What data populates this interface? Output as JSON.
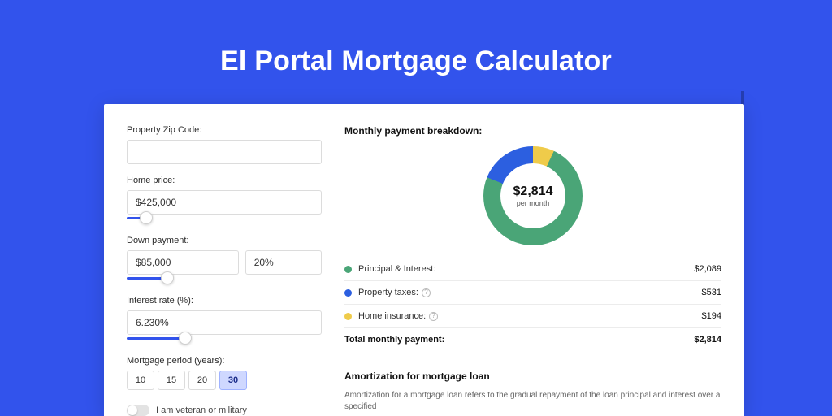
{
  "hero": {
    "title": "El Portal Mortgage Calculator"
  },
  "form": {
    "zip": {
      "label": "Property Zip Code:",
      "value": ""
    },
    "home_price": {
      "label": "Home price:",
      "value": "$425,000",
      "slider_pct": 10
    },
    "down_payment": {
      "label": "Down payment:",
      "amount": "$85,000",
      "percent": "20%",
      "slider_pct": 20
    },
    "interest_rate": {
      "label": "Interest rate (%):",
      "value": "6.230%",
      "slider_pct": 30
    },
    "period": {
      "label": "Mortgage period (years):",
      "options": [
        "10",
        "15",
        "20",
        "30"
      ],
      "active": "30"
    },
    "veteran": {
      "label": "I am veteran or military",
      "on": false
    }
  },
  "breakdown": {
    "title": "Monthly payment breakdown:",
    "center_amount": "$2,814",
    "center_sub": "per month",
    "items": [
      {
        "name": "Principal & Interest:",
        "value": "$2,089",
        "color": "#4aa577",
        "info": false
      },
      {
        "name": "Property taxes:",
        "value": "$531",
        "color": "#2c5fe0",
        "info": true
      },
      {
        "name": "Home insurance:",
        "value": "$194",
        "color": "#efcb4a",
        "info": true
      }
    ],
    "total_label": "Total monthly payment:",
    "total_value": "$2,814"
  },
  "amort": {
    "title": "Amortization for mortgage loan",
    "text": "Amortization for a mortgage loan refers to the gradual repayment of the loan principal and interest over a specified"
  },
  "chart_data": {
    "type": "pie",
    "title": "Monthly payment breakdown",
    "series": [
      {
        "name": "Principal & Interest",
        "value": 2089,
        "color": "#4aa577"
      },
      {
        "name": "Property taxes",
        "value": 531,
        "color": "#2c5fe0"
      },
      {
        "name": "Home insurance",
        "value": 194,
        "color": "#efcb4a"
      }
    ],
    "total": 2814,
    "center_label": "$2,814 per month"
  }
}
